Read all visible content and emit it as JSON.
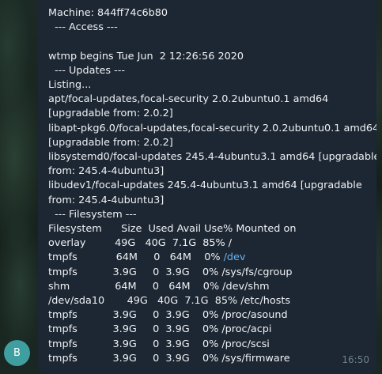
{
  "chat": {
    "avatar_initial": "B",
    "timestamp": "16:50",
    "lines": [
      "Machine: 844ff74c6b80",
      "  --- Access ---",
      "",
      "wtmp begins Tue Jun  2 12:26:56 2020",
      "  --- Updates ---",
      "Listing...",
      "apt/focal-updates,focal-security 2.0.2ubuntu0.1 amd64",
      "[upgradable from: 2.0.2]",
      "libapt-pkg6.0/focal-updates,focal-security 2.0.2ubuntu0.1 amd64",
      "[upgradable from: 2.0.2]",
      "libsystemd0/focal-updates 245.4-4ubuntu3.1 amd64 [upgradable",
      "from: 245.4-4ubuntu3]",
      "libudev1/focal-updates 245.4-4ubuntu3.1 amd64 [upgradable",
      "from: 245.4-4ubuntu3]",
      "  --- Filesystem ---",
      "Filesystem      Size  Used Avail Use% Mounted on",
      "overlay         49G   40G  7.1G  85% /",
      "tmpfs            64M     0   64M    0% ",
      "tmpfs           3.9G     0  3.9G    0% /sys/fs/cgroup",
      "shm              64M     0   64M    0% /dev/shm",
      "/dev/sda10       49G   40G  7.1G  85% /etc/hosts",
      "tmpfs           3.9G     0  3.9G    0% /proc/asound",
      "tmpfs           3.9G     0  3.9G    0% /proc/acpi",
      "tmpfs           3.9G     0  3.9G    0% /proc/scsi",
      "tmpfs           3.9G     0  3.9G    0% /sys/firmware"
    ],
    "link_text": "/dev"
  }
}
